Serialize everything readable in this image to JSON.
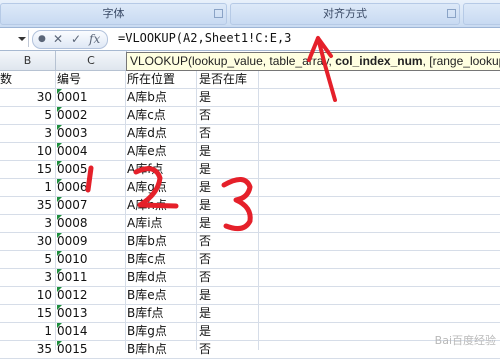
{
  "ribbon": {
    "groups": [
      "字体",
      "对齐方式"
    ]
  },
  "formula_bar": {
    "buttons": [
      "✕",
      "✓",
      "fx"
    ],
    "formula": "=VLOOKUP(A2,Sheet1!C:E,3"
  },
  "tooltip": {
    "prefix": "VLOOKUP(lookup_value, table_array, ",
    "active_arg": "col_index_num",
    "suffix": ", [range_lookup])"
  },
  "columns": {
    "B": "B",
    "C": "C"
  },
  "header_row": {
    "B": "数",
    "C": "编号",
    "D": "所在位置",
    "E": "是否在库"
  },
  "rows": [
    {
      "B": "30",
      "C": "0001",
      "D": "A库b点",
      "E": "是"
    },
    {
      "B": "5",
      "C": "0002",
      "D": "A库c点",
      "E": "否"
    },
    {
      "B": "3",
      "C": "0003",
      "D": "A库d点",
      "E": "否"
    },
    {
      "B": "10",
      "C": "0004",
      "D": "A库e点",
      "E": "是"
    },
    {
      "B": "15",
      "C": "0005",
      "D": "A库f点",
      "E": "是"
    },
    {
      "B": "1",
      "C": "0006",
      "D": "A库g点",
      "E": "是"
    },
    {
      "B": "35",
      "C": "0007",
      "D": "A库h点",
      "E": "是"
    },
    {
      "B": "3",
      "C": "0008",
      "D": "A库i点",
      "E": "是"
    },
    {
      "B": "30",
      "C": "0009",
      "D": "B库b点",
      "E": "否"
    },
    {
      "B": "5",
      "C": "0010",
      "D": "B库c点",
      "E": "否"
    },
    {
      "B": "3",
      "C": "0011",
      "D": "B库d点",
      "E": "否"
    },
    {
      "B": "10",
      "C": "0012",
      "D": "B库e点",
      "E": "是"
    },
    {
      "B": "15",
      "C": "0013",
      "D": "B库f点",
      "E": "是"
    },
    {
      "B": "1",
      "C": "0014",
      "D": "B库g点",
      "E": "是"
    },
    {
      "B": "35",
      "C": "0015",
      "D": "B库h点",
      "E": "否"
    }
  ],
  "annotations": {
    "numbers": [
      "1",
      "2",
      "3"
    ],
    "ink_color": "#e5202a"
  },
  "watermark": "Bai百度经验"
}
